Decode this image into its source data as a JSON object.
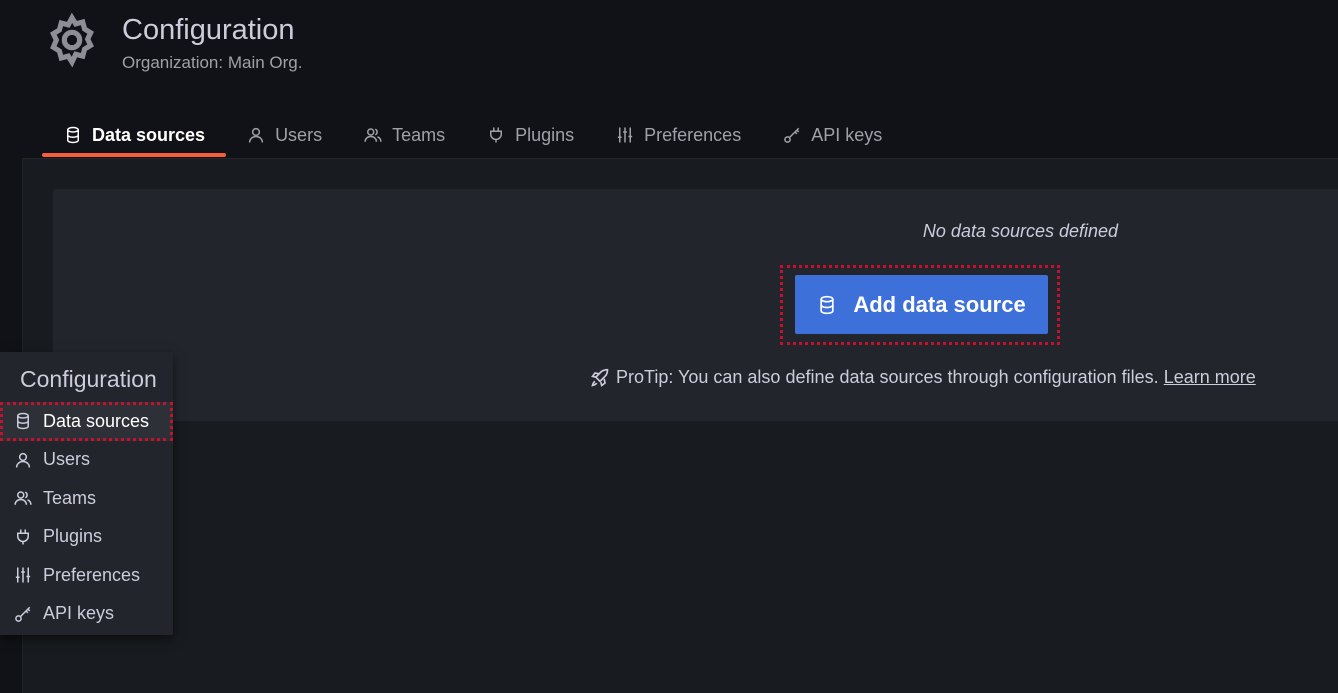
{
  "header": {
    "icon": "gear-icon",
    "title": "Configuration",
    "subtitle": "Organization: Main Org."
  },
  "tabs": [
    {
      "label": "Data sources",
      "icon": "database-icon",
      "active": true
    },
    {
      "label": "Users",
      "icon": "user-icon",
      "active": false
    },
    {
      "label": "Teams",
      "icon": "users-icon",
      "active": false
    },
    {
      "label": "Plugins",
      "icon": "plug-icon",
      "active": false
    },
    {
      "label": "Preferences",
      "icon": "sliders-icon",
      "active": false
    },
    {
      "label": "API keys",
      "icon": "key-icon",
      "active": false
    }
  ],
  "empty_state": {
    "title": "No data sources defined",
    "button_label": "Add data source",
    "button_icon": "database-icon",
    "protip_icon": "rocket-icon",
    "protip_text": "ProTip: You can also define data sources through configuration files.",
    "learn_more": "Learn more"
  },
  "flyout": {
    "title": "Configuration",
    "items": [
      {
        "label": "Data sources",
        "icon": "database-icon",
        "active": true
      },
      {
        "label": "Users",
        "icon": "user-icon",
        "active": false
      },
      {
        "label": "Teams",
        "icon": "users-icon",
        "active": false
      },
      {
        "label": "Plugins",
        "icon": "plug-icon",
        "active": false
      },
      {
        "label": "Preferences",
        "icon": "sliders-icon",
        "active": false
      },
      {
        "label": "API keys",
        "icon": "key-icon",
        "active": false
      }
    ]
  },
  "colors": {
    "background": "#111217",
    "panel": "#22252b",
    "primary_button": "#3d71d9",
    "active_tab_underline": "#f55f3e",
    "highlight_outline": "#c8102e"
  }
}
